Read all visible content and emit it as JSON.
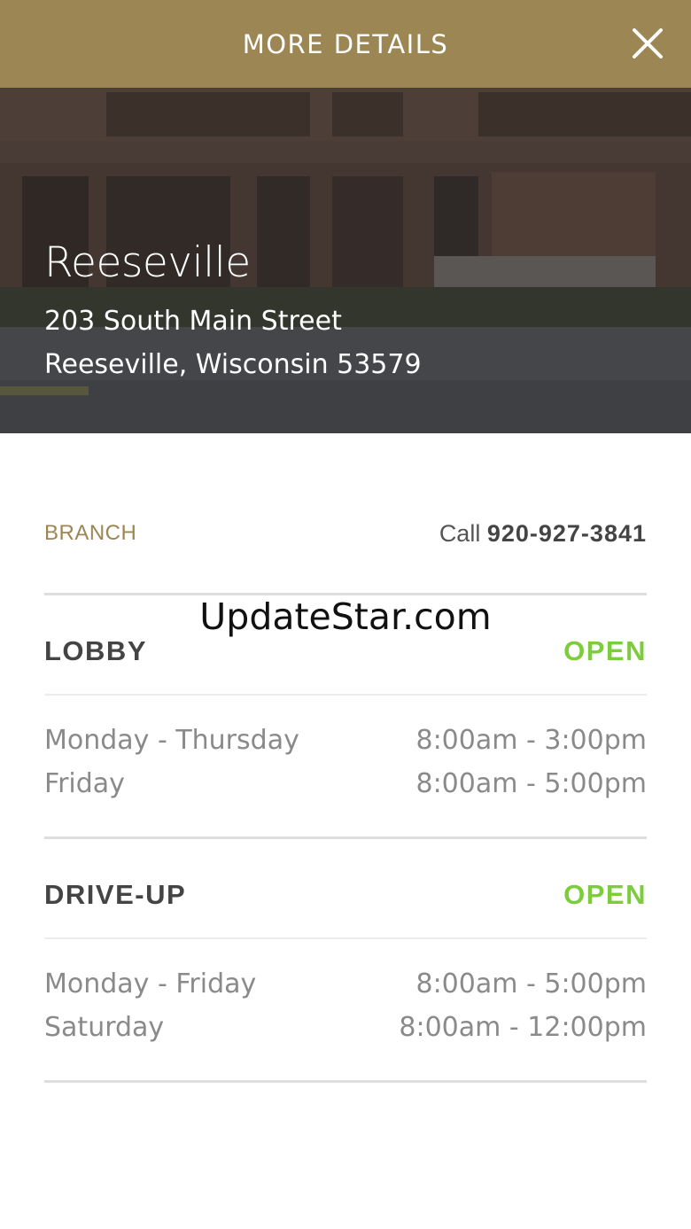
{
  "header": {
    "title": "MORE DETAILS",
    "close_icon": "close-icon"
  },
  "hero": {
    "name": "Reeseville",
    "address_line1": "203 South Main Street",
    "address_line2": "Reeseville, Wisconsin 53579"
  },
  "branch": {
    "label": "BRANCH",
    "call_prefix": "Call",
    "phone": "920-927-3841"
  },
  "watermark": "UpdateStar.com",
  "lobby": {
    "title": "LOBBY",
    "status": "OPEN",
    "hours": [
      {
        "days": "Monday - Thursday",
        "time": "8:00am - 3:00pm"
      },
      {
        "days": "Friday",
        "time": "8:00am - 5:00pm"
      }
    ]
  },
  "driveup": {
    "title": "DRIVE-UP",
    "status": "OPEN",
    "hours": [
      {
        "days": "Monday - Friday",
        "time": "8:00am - 5:00pm"
      },
      {
        "days": "Saturday",
        "time": "8:00am - 12:00pm"
      }
    ]
  },
  "colors": {
    "header_bg": "#9b8654",
    "accent_gold": "#9b8654",
    "open_green": "#7ccc3c"
  }
}
